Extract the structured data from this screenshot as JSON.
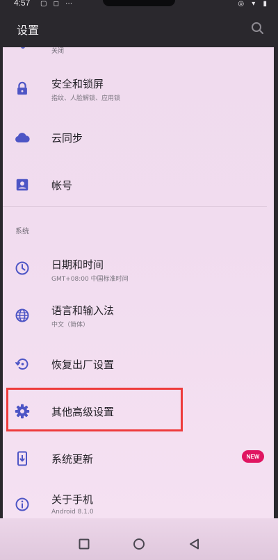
{
  "status_bar": {
    "time": "4:57",
    "left_icons": "▢ ◻ ⋯",
    "right_icons": "◎ ▾ ▮"
  },
  "header": {
    "title": "设置",
    "search_icon": "search-icon"
  },
  "top_clipped": {
    "label": "关闭"
  },
  "rows": [
    {
      "title": "安全和锁屏",
      "subtitle": "指纹、人脸解锁、应用锁",
      "icon": "lock-icon"
    },
    {
      "title": "云同步",
      "subtitle": "",
      "icon": "cloud-icon"
    },
    {
      "title": "帐号",
      "subtitle": "",
      "icon": "account-box-icon"
    }
  ],
  "section": {
    "label": "系统"
  },
  "system_rows": [
    {
      "title": "日期和时间",
      "subtitle": "GMT+08:00 中国标准时间",
      "icon": "clock-icon"
    },
    {
      "title": "语言和输入法",
      "subtitle": "中文（简体）",
      "icon": "globe-icon"
    },
    {
      "title": "恢复出厂设置",
      "subtitle": "",
      "icon": "restore-icon"
    },
    {
      "title": "其他高级设置",
      "subtitle": "",
      "icon": "gear-icon"
    },
    {
      "title": "系统更新",
      "subtitle": "",
      "icon": "system-update-icon",
      "badge": "NEW"
    },
    {
      "title": "关于手机",
      "subtitle": "Android 8.1.0",
      "icon": "info-icon"
    }
  ],
  "colors": {
    "accent": "#4d55c5",
    "highlight": "#ee3b3b",
    "badge": "#e01561"
  }
}
